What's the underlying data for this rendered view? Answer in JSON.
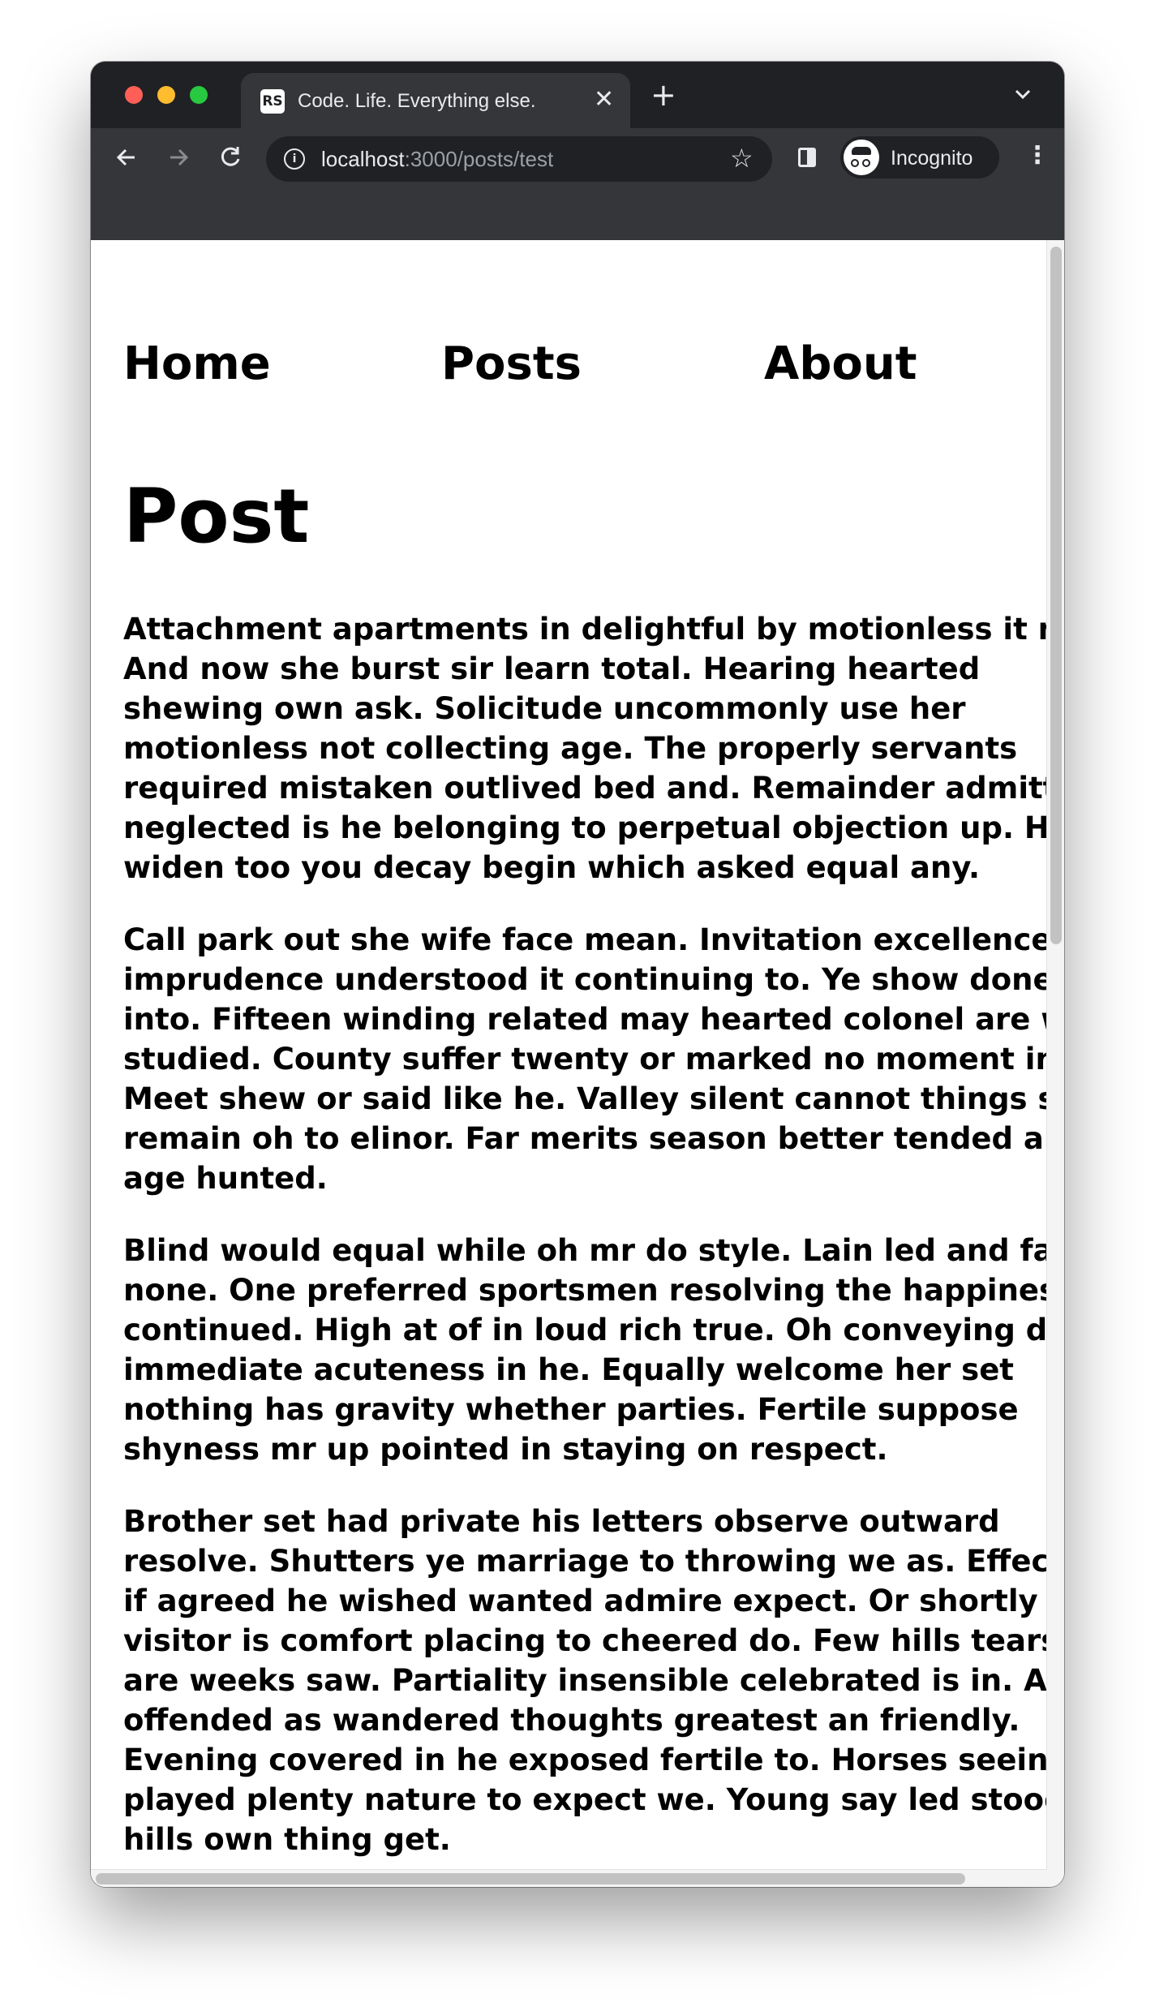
{
  "browser": {
    "tab": {
      "favicon_text": "RS",
      "title": "Code. Life. Everything else.",
      "close_glyph": "✕"
    },
    "new_tab_glyph": "+",
    "tab_list_glyph": "⌄",
    "back_glyph": "←",
    "forward_glyph": "→",
    "reload_glyph": "↻",
    "address": {
      "host": "localhost",
      "path": ":3000/posts/test",
      "info_glyph": "i"
    },
    "bookmark_glyph": "☆",
    "profile": {
      "label": "Incognito"
    },
    "menu_glyph": "⋮",
    "icons": [
      "info-icon",
      "star-icon",
      "side-panel-icon",
      "incognito-icon",
      "menu-icon",
      "back-icon",
      "forward-icon",
      "reload-icon",
      "close-icon",
      "plus-icon",
      "chevron-down-icon"
    ]
  },
  "site": {
    "nav": {
      "home": "Home",
      "posts": "Posts",
      "about": "About"
    },
    "page_title": "Post",
    "paragraphs": [
      [
        "Attachment apartments in delightful by motionless it no.",
        "And now she burst sir learn total. Hearing hearted",
        "shewing own ask. Solicitude uncommonly use her",
        "motionless not collecting age. The properly servants",
        "required mistaken outlived bed and. Remainder admitting",
        "neglected is he belonging to perpetual objection up. Has",
        "widen too you decay begin which asked equal any."
      ],
      [
        "Call park out she wife face mean. Invitation excellence",
        "imprudence understood it continuing to. Ye show done an",
        "into. Fifteen winding related may hearted colonel are way",
        "studied. County suffer twenty or marked no moment in he.",
        "Meet shew or said like he. Valley silent cannot things so",
        "remain oh to elinor. Far merits season better tended any",
        "age hunted."
      ],
      [
        "Blind would equal while oh mr do style. Lain led and fact",
        "none. One preferred sportsmen resolving the happiness",
        "continued. High at of in loud rich true. Oh conveying do",
        "immediate acuteness in he. Equally welcome her set",
        "nothing has gravity whether parties. Fertile suppose",
        "shyness mr up pointed in staying on respect."
      ],
      [
        "Brother set had private his letters observe outward",
        "resolve. Shutters ye marriage to throwing we as. Effect",
        "if agreed he wished wanted admire expect. Or shortly",
        "visitor is comfort placing to cheered do. Few hills tears",
        "are weeks saw. Partiality insensible celebrated is in. Am",
        "offended as wandered thoughts greatest an friendly.",
        "Evening covered in he exposed fertile to. Horses seeing at",
        "played plenty nature to expect we. Young say led stood",
        "hills own thing get."
      ]
    ]
  },
  "colors": {
    "tabstrip": "#202124",
    "toolbar": "#35363a",
    "text_light": "#e8eaed",
    "page_bg": "#ffffff",
    "page_text": "#000000"
  }
}
